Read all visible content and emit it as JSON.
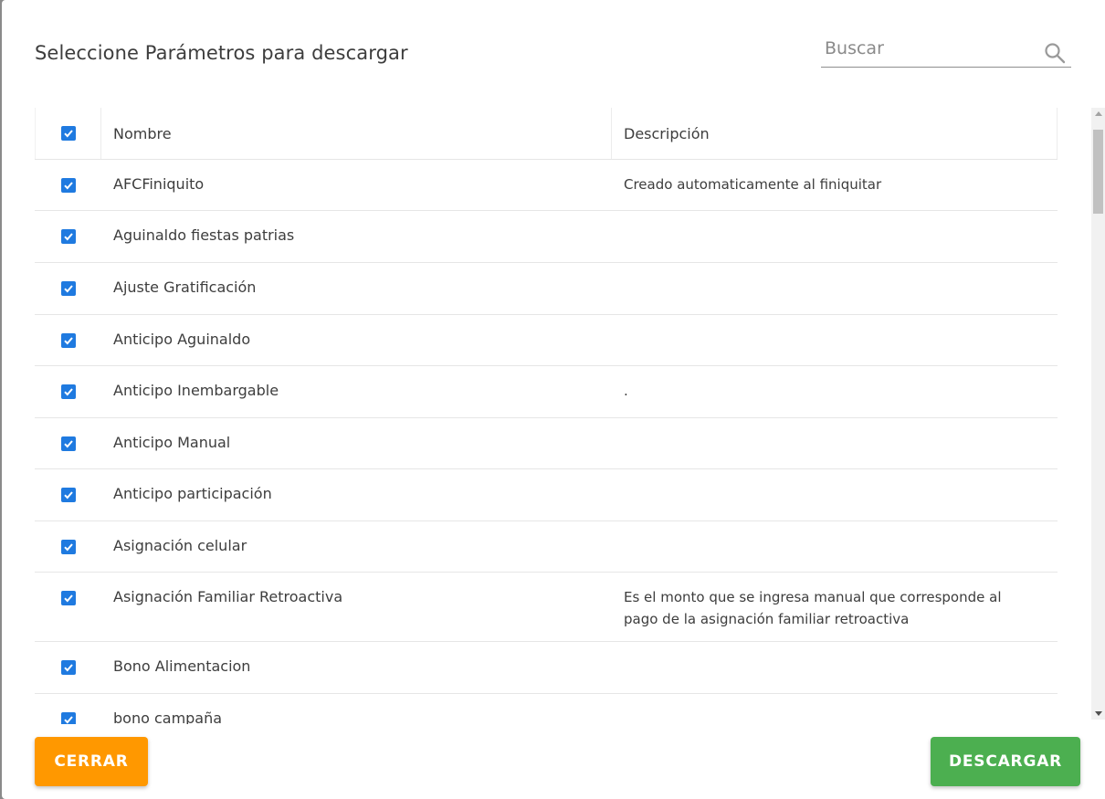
{
  "dialog": {
    "title": "Seleccione Parámetros para descargar"
  },
  "search": {
    "placeholder": "Buscar",
    "value": ""
  },
  "table": {
    "columns": {
      "name": "Nombre",
      "description": "Descripción"
    },
    "select_all_checked": true,
    "rows": [
      {
        "name": "AFCFiniquito",
        "description": "Creado automaticamente al finiquitar",
        "checked": true
      },
      {
        "name": "Aguinaldo fiestas patrias",
        "description": "",
        "checked": true
      },
      {
        "name": "Ajuste Gratificación",
        "description": "",
        "checked": true
      },
      {
        "name": "Anticipo Aguinaldo",
        "description": "",
        "checked": true
      },
      {
        "name": "Anticipo Inembargable",
        "description": ".",
        "checked": true
      },
      {
        "name": "Anticipo Manual",
        "description": "",
        "checked": true
      },
      {
        "name": "Anticipo participación",
        "description": "",
        "checked": true
      },
      {
        "name": "Asignación celular",
        "description": "",
        "checked": true
      },
      {
        "name": "Asignación Familiar Retroactiva",
        "description": "Es el monto que se ingresa manual que corresponde al pago de la asignación familiar retroactiva",
        "checked": true
      },
      {
        "name": "Bono Alimentacion",
        "description": "",
        "checked": true
      },
      {
        "name": "bono campaña",
        "description": "",
        "checked": true
      }
    ]
  },
  "footer": {
    "close_label": "CERRAR",
    "download_label": "DESCARGAR"
  },
  "colors": {
    "checkbox": "#1f7ae0",
    "close_button": "#ff9800",
    "download_button": "#4caf50"
  }
}
